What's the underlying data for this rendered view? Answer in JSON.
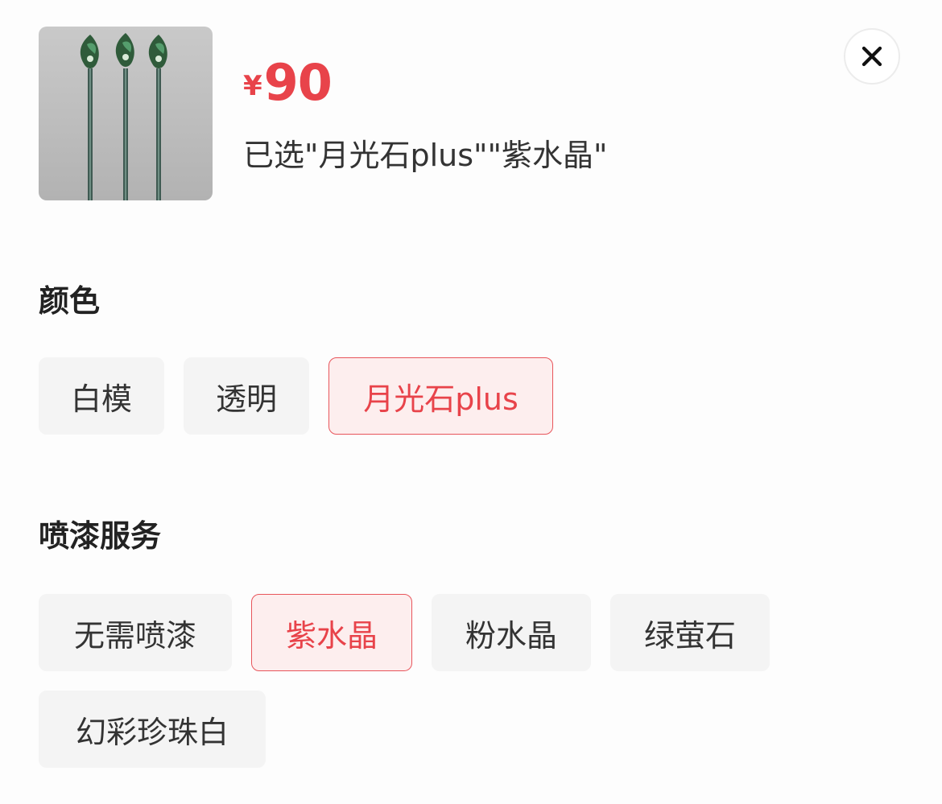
{
  "product": {
    "image_icon": "product-thumbnail-three-staffs",
    "price_currency": "¥",
    "price_value": "90",
    "selected_text": "已选\"月光石plus\"\"紫水晶\""
  },
  "close": {
    "icon": "close-icon"
  },
  "color_section": {
    "title": "颜色",
    "options": [
      {
        "label": "白模",
        "selected": false
      },
      {
        "label": "透明",
        "selected": false
      },
      {
        "label": "月光石plus",
        "selected": true
      }
    ]
  },
  "paint_section": {
    "title": "喷漆服务",
    "options": [
      {
        "label": "无需喷漆",
        "selected": false
      },
      {
        "label": "紫水晶",
        "selected": true
      },
      {
        "label": "粉水晶",
        "selected": false
      },
      {
        "label": "绿萤石",
        "selected": false
      },
      {
        "label": "幻彩珍珠白",
        "selected": false
      }
    ]
  },
  "colors": {
    "accent": "#e8434a",
    "chip_bg": "#f4f4f4",
    "chip_selected_bg": "#fdeeee"
  }
}
